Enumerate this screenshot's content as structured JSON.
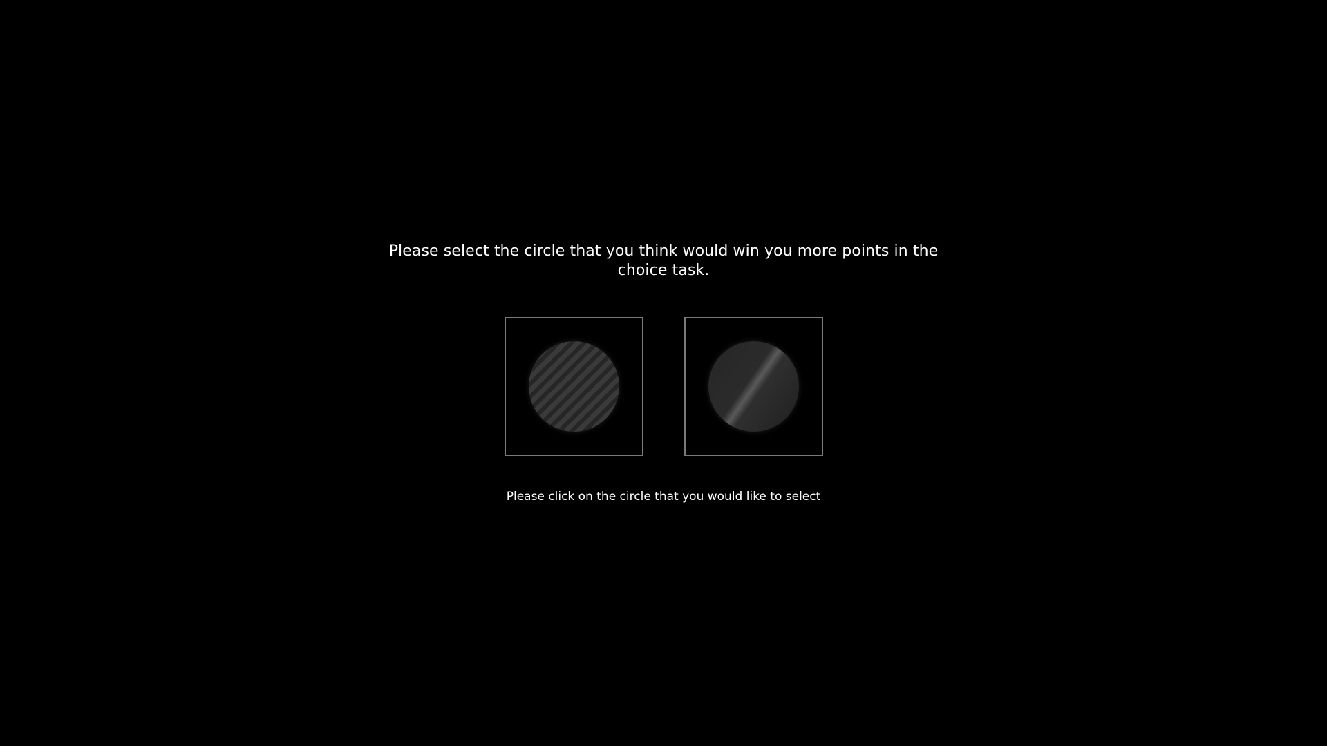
{
  "prompt": {
    "line1": "Please select the circle that you think would win you more points in the",
    "line2": "choice task."
  },
  "choices": [
    {
      "id": "left",
      "pattern": "diagonal-stripes"
    },
    {
      "id": "right",
      "pattern": "diagonal-sheen"
    }
  ],
  "instruction": "Please click on the circle that you would like to select",
  "colors": {
    "background": "#000000",
    "text": "#ffffff",
    "box_border": "#7a7a7a"
  }
}
